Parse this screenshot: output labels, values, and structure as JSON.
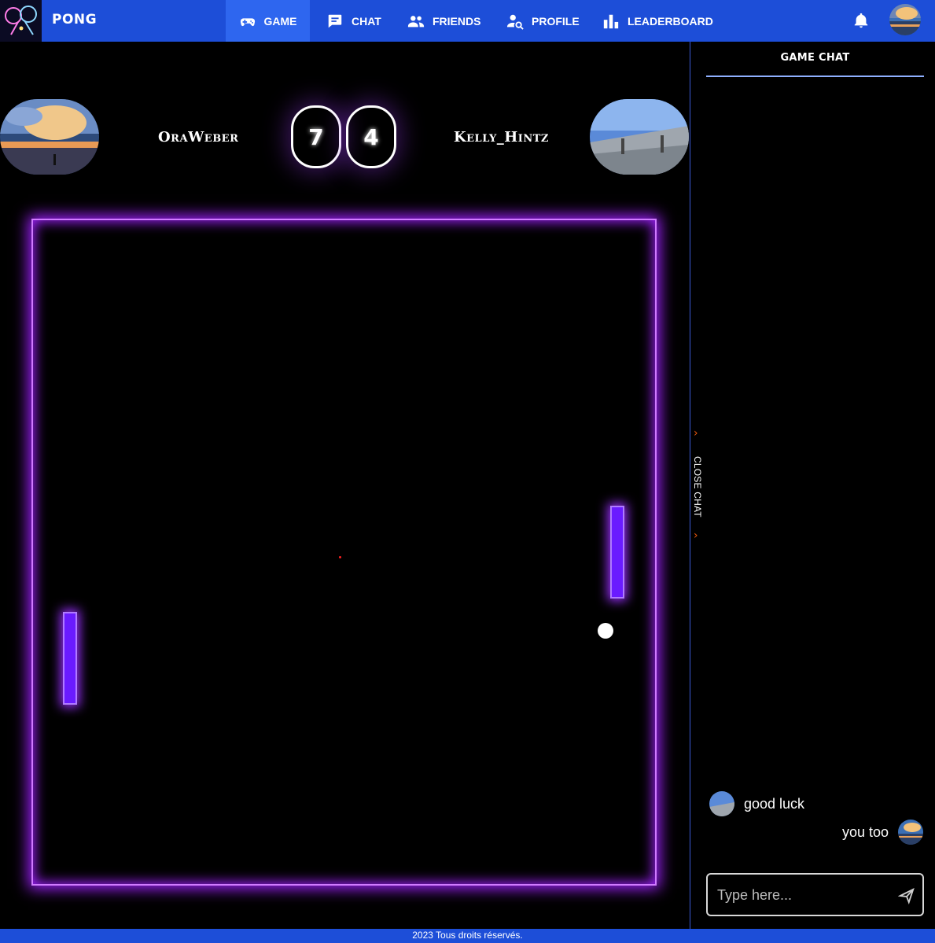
{
  "navbar": {
    "brand": "PONG",
    "items": [
      {
        "label": "GAME",
        "icon": "gamepad-icon",
        "active": true
      },
      {
        "label": "CHAT",
        "icon": "chat-icon",
        "active": false
      },
      {
        "label": "FRIENDS",
        "icon": "friends-icon",
        "active": false
      },
      {
        "label": "PROFILE",
        "icon": "profile-search-icon",
        "active": false
      },
      {
        "label": "LEADERBOARD",
        "icon": "leaderboard-icon",
        "active": false
      }
    ],
    "accent": "#1d4ed8"
  },
  "game": {
    "player_left": {
      "name": "OraWeber",
      "score": "7"
    },
    "player_right": {
      "name": "Kelly_Hintz",
      "score": "4"
    },
    "field_color": "#d07bff",
    "paddle_color": "#6a1bff"
  },
  "chat": {
    "title": "GAME CHAT",
    "toggle_label": "CLOSE CHAT",
    "messages": [
      {
        "text": "good luck",
        "side": "left"
      },
      {
        "text": "you too",
        "side": "right"
      }
    ],
    "input_placeholder": "Type here..."
  },
  "footer": {
    "text": "2023 Tous droits réservés."
  }
}
